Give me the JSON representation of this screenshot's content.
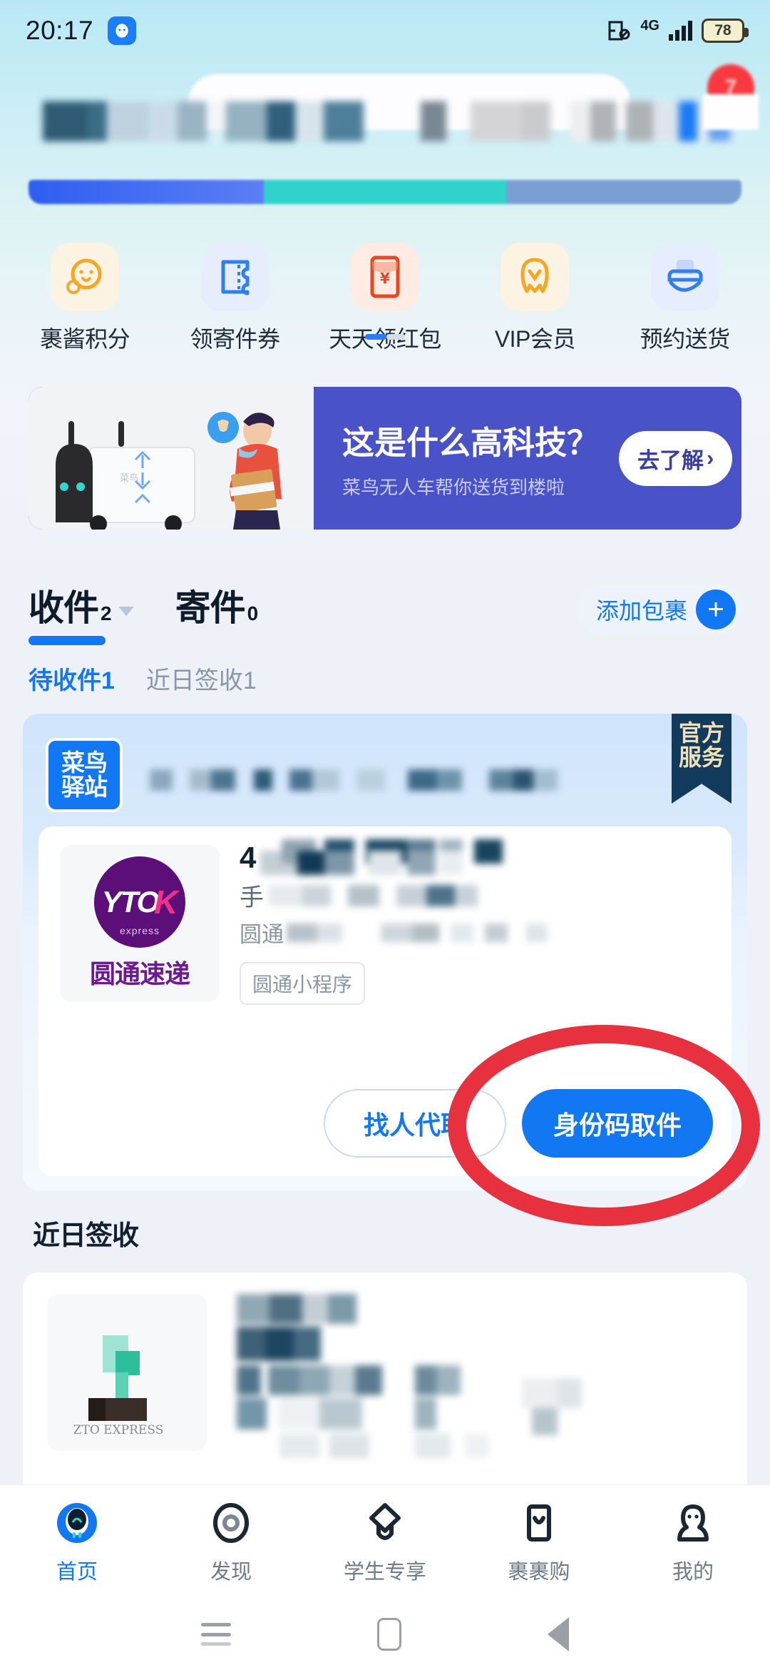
{
  "status_bar": {
    "time": "20:17",
    "app_icon": "cainiao-app-icon",
    "mute_icon": "mute-icon",
    "network": "4G",
    "battery": "78"
  },
  "header": {
    "notification_badge": "7",
    "search_placeholder_redacted": true
  },
  "quick_actions": [
    {
      "label": "裹酱积分",
      "icon": "coin-face-icon",
      "bg": "#fdf3e2"
    },
    {
      "label": "领寄件券",
      "icon": "coupon-icon",
      "bg": "#e6eefd"
    },
    {
      "label": "天天领红包",
      "icon": "red-packet-icon",
      "bg": "#fdebe4"
    },
    {
      "label": "VIP会员",
      "icon": "vip-crown-icon",
      "bg": "#fdf3e2"
    },
    {
      "label": "预约送货",
      "icon": "delivery-box-icon",
      "bg": "#e6eefd"
    }
  ],
  "pagination": {
    "active_index": 0,
    "total": 2
  },
  "promo_banner": {
    "title": "这是什么高科技？",
    "subtitle": "菜鸟无人车帮你送货到楼啦",
    "button_label": "去了解",
    "button_chevron": "›",
    "bg_color": "#4a52c8"
  },
  "tabs": {
    "items": [
      {
        "label": "收件",
        "count": "2",
        "active": true,
        "has_caret": true
      },
      {
        "label": "寄件",
        "count": "0",
        "active": false,
        "has_caret": false
      }
    ],
    "add_package": {
      "label": "添加包裹",
      "icon": "plus-icon"
    }
  },
  "sub_tabs": [
    {
      "label": "待收件1",
      "active": true
    },
    {
      "label": "近日签收1",
      "active": false
    }
  ],
  "package_card": {
    "station_badge": {
      "line1": "菜鸟",
      "line2": "驿站"
    },
    "station_name_redacted": true,
    "ribbon": {
      "line1": "官方",
      "line2": "服务"
    },
    "carrier": {
      "logo_text": "YTO",
      "logo_accent": "K",
      "logo_sub": "express",
      "name_cn": "圆通速递",
      "logo_color": "#5c0f78",
      "accent_color": "#f0308c"
    },
    "lines": [
      {
        "lead": "4",
        "redacted": true,
        "style": "code"
      },
      {
        "lead": "手",
        "redacted": true,
        "style": "phone"
      },
      {
        "lead": "圆通",
        "redacted": true,
        "style": "carrier"
      }
    ],
    "mini_tag": "圆通小程序",
    "buttons": [
      {
        "label": "找人代取",
        "style": "ghost"
      },
      {
        "label": "身份码取件",
        "style": "primary",
        "highlighted": true
      }
    ]
  },
  "annotation": {
    "shape": "ellipse",
    "color": "#e8313f",
    "target": "身份码取件"
  },
  "recent_section": {
    "title": "近日签收",
    "card": {
      "carrier_logo": "zto-express-logo",
      "logo_caption": "ZTO EXPRESS",
      "content_redacted": true
    }
  },
  "bottom_nav": [
    {
      "label": "首页",
      "icon": "home-cainiao-icon",
      "active": true
    },
    {
      "label": "发现",
      "icon": "discover-circle-icon",
      "active": false
    },
    {
      "label": "学生专享",
      "icon": "graduation-cap-icon",
      "active": false
    },
    {
      "label": "裹裹购",
      "icon": "phone-shop-icon",
      "active": false
    },
    {
      "label": "我的",
      "icon": "profile-person-icon",
      "active": false
    }
  ],
  "android_nav": [
    {
      "icon": "recents-icon"
    },
    {
      "icon": "home-icon"
    },
    {
      "icon": "back-icon"
    }
  ],
  "colors": {
    "primary_blue": "#1177f2",
    "badge_red": "#f8393f",
    "annotation_red": "#e8313f",
    "promo_purple": "#4a52c8",
    "yto_purple": "#5c0f78"
  }
}
